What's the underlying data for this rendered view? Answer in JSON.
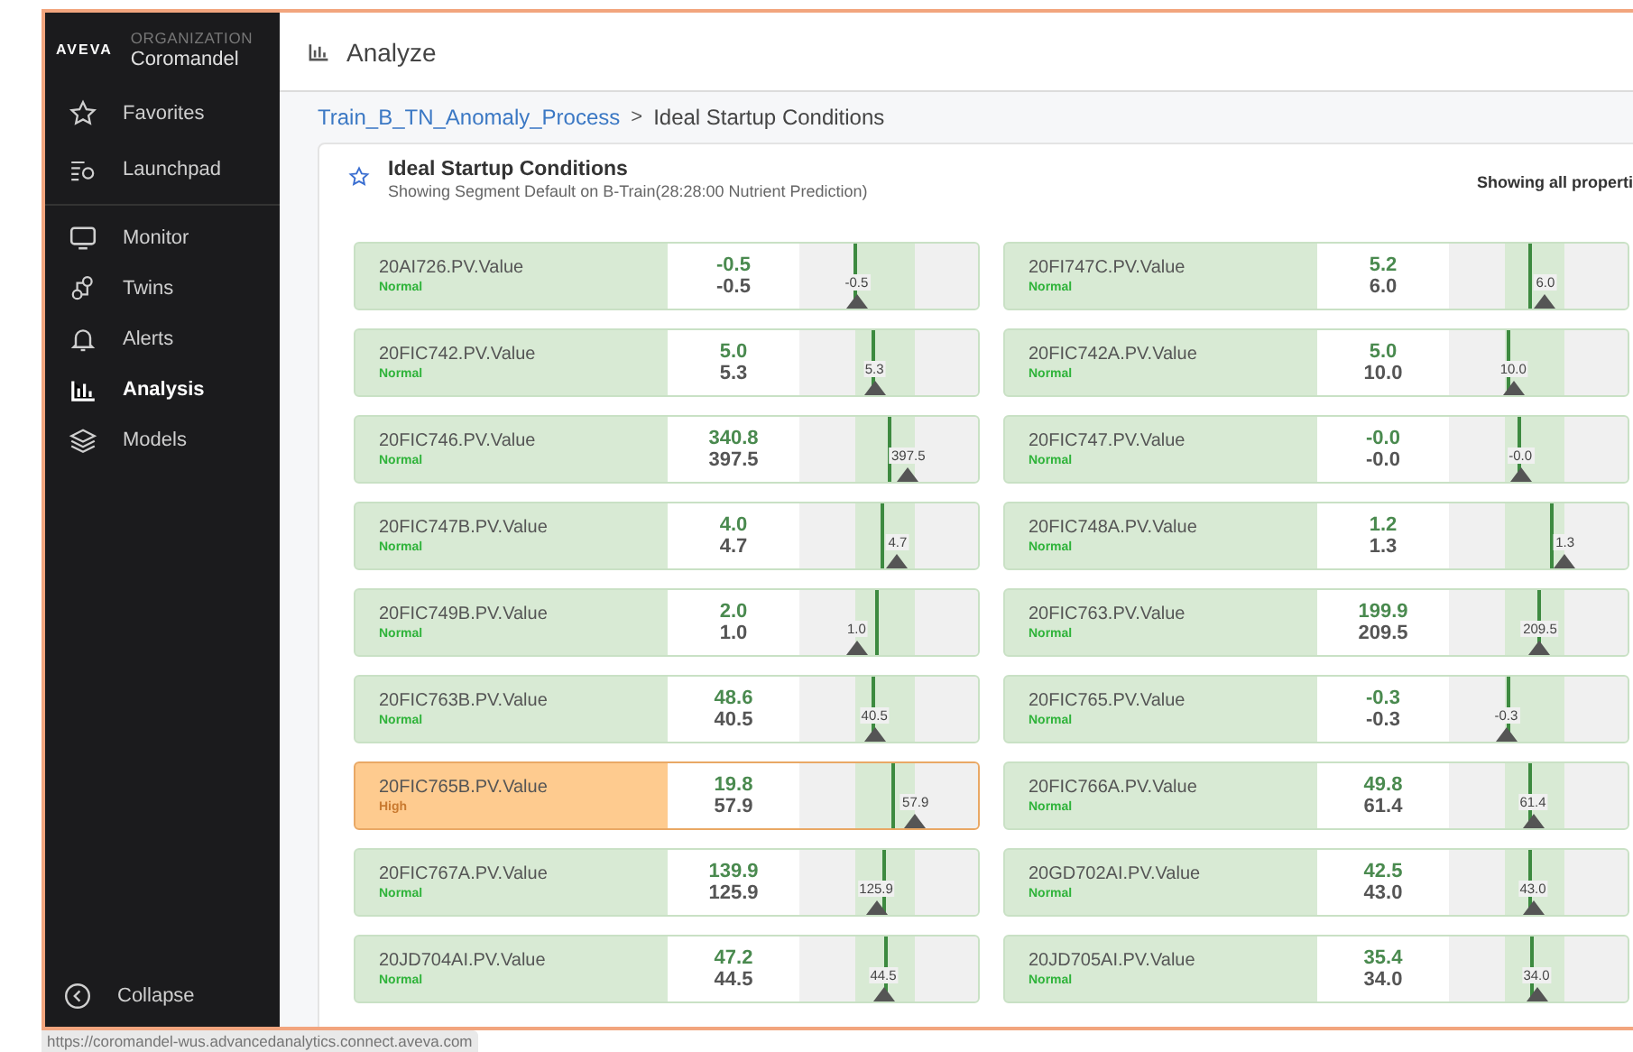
{
  "sidebar": {
    "logo": "AVEVA",
    "org_label": "ORGANIZATION",
    "org_name": "Coromandel",
    "top_items": [
      {
        "label": "Favorites",
        "selected": false
      },
      {
        "label": "Launchpad",
        "selected": false
      }
    ],
    "items": [
      {
        "label": "Monitor",
        "selected": false
      },
      {
        "label": "Twins",
        "selected": false
      },
      {
        "label": "Alerts",
        "selected": false
      },
      {
        "label": "Analysis",
        "selected": true
      },
      {
        "label": "Models",
        "selected": false
      }
    ],
    "collapse": "Collapse"
  },
  "header": {
    "title": "Analyze"
  },
  "breadcrumb": {
    "parent": "Train_B_TN_Anomaly_Process",
    "separator": ">",
    "current": "Ideal Startup Conditions"
  },
  "card": {
    "title": "Ideal Startup Conditions",
    "subtitle": "Showing Segment Default on B-Train(28:28:00 Nutrient Prediction)",
    "filter_note": "Showing all properti"
  },
  "tiles": [
    {
      "name": "20AI726.PV.Value",
      "status": "Normal",
      "kind": "normal",
      "ideal": "-0.5",
      "actual": "-0.5",
      "ideal_line": {
        "level": 0.31
      },
      "actual_marker": {
        "level": 0.32,
        "label": "-0.5"
      }
    },
    {
      "name": "20FI747C.PV.Value",
      "status": "Normal",
      "kind": "normal",
      "ideal": "5.2",
      "actual": "6.0",
      "ideal_line": {
        "level": 0.45
      },
      "actual_marker": {
        "level": 0.54,
        "label": "6.0"
      }
    },
    {
      "name": "20FIC742.PV.Value",
      "status": "Normal",
      "kind": "normal",
      "ideal": "5.0",
      "actual": "5.3",
      "ideal_line": {
        "level": 0.41
      },
      "actual_marker": {
        "level": 0.42,
        "label": "5.3"
      }
    },
    {
      "name": "20FIC742A.PV.Value",
      "status": "Normal",
      "kind": "normal",
      "ideal": "5.0",
      "actual": "10.0",
      "ideal_line": {
        "level": 0.33
      },
      "actual_marker": {
        "level": 0.36,
        "label": "10.0"
      }
    },
    {
      "name": "20FIC746.PV.Value",
      "status": "Normal",
      "kind": "normal",
      "ideal": "340.8",
      "actual": "397.5",
      "ideal_line": {
        "level": 0.5
      },
      "actual_marker": {
        "level": 0.61,
        "label": "397.5"
      }
    },
    {
      "name": "20FIC747.PV.Value",
      "status": "Normal",
      "kind": "normal",
      "ideal": "-0.0",
      "actual": "-0.0",
      "ideal_line": {
        "level": 0.39
      },
      "actual_marker": {
        "level": 0.4,
        "label": "-0.0"
      }
    },
    {
      "name": "20FIC747B.PV.Value",
      "status": "Normal",
      "kind": "normal",
      "ideal": "4.0",
      "actual": "4.7",
      "ideal_line": {
        "level": 0.46
      },
      "actual_marker": {
        "level": 0.55,
        "label": "4.7"
      }
    },
    {
      "name": "20FIC748A.PV.Value",
      "status": "Normal",
      "kind": "normal",
      "ideal": "1.2",
      "actual": "1.3",
      "ideal_line": {
        "level": 0.58
      },
      "actual_marker": {
        "level": 0.65,
        "label": "1.3"
      }
    },
    {
      "name": "20FIC749B.PV.Value",
      "status": "Normal",
      "kind": "normal",
      "ideal": "2.0",
      "actual": "1.0",
      "ideal_line": {
        "level": 0.43
      },
      "actual_marker": {
        "level": 0.32,
        "label": "1.0"
      }
    },
    {
      "name": "20FIC763.PV.Value",
      "status": "Normal",
      "kind": "normal",
      "ideal": "199.9",
      "actual": "209.5",
      "ideal_line": {
        "level": 0.5
      },
      "actual_marker": {
        "level": 0.51,
        "label": "209.5"
      }
    },
    {
      "name": "20FIC763B.PV.Value",
      "status": "Normal",
      "kind": "normal",
      "ideal": "48.6",
      "actual": "40.5",
      "ideal_line": {
        "level": 0.41
      },
      "actual_marker": {
        "level": 0.42,
        "label": "40.5"
      }
    },
    {
      "name": "20FIC765.PV.Value",
      "status": "Normal",
      "kind": "normal",
      "ideal": "-0.3",
      "actual": "-0.3",
      "ideal_line": {
        "level": 0.33
      },
      "actual_marker": {
        "level": 0.32,
        "label": "-0.3"
      }
    },
    {
      "name": "20FIC765B.PV.Value",
      "status": "High",
      "kind": "high",
      "ideal": "19.8",
      "actual": "57.9",
      "ideal_line": {
        "level": 0.53
      },
      "actual_marker": {
        "level": 0.65,
        "label": "57.9"
      }
    },
    {
      "name": "20FIC766A.PV.Value",
      "status": "Normal",
      "kind": "normal",
      "ideal": "49.8",
      "actual": "61.4",
      "ideal_line": {
        "level": 0.45
      },
      "actual_marker": {
        "level": 0.47,
        "label": "61.4"
      }
    },
    {
      "name": "20FIC767A.PV.Value",
      "status": "Normal",
      "kind": "normal",
      "ideal": "139.9",
      "actual": "125.9",
      "ideal_line": {
        "level": 0.47
      },
      "actual_marker": {
        "level": 0.43,
        "label": "125.9"
      }
    },
    {
      "name": "20GD702AI.PV.Value",
      "status": "Normal",
      "kind": "normal",
      "ideal": "42.5",
      "actual": "43.0",
      "ideal_line": {
        "level": 0.45
      },
      "actual_marker": {
        "level": 0.47,
        "label": "43.0"
      }
    },
    {
      "name": "20JD704AI.PV.Value",
      "status": "Normal",
      "kind": "normal",
      "ideal": "47.2",
      "actual": "44.5",
      "ideal_line": {
        "level": 0.48
      },
      "actual_marker": {
        "level": 0.47,
        "label": "44.5"
      }
    },
    {
      "name": "20JD705AI.PV.Value",
      "status": "Normal",
      "kind": "normal",
      "ideal": "35.4",
      "actual": "34.0",
      "ideal_line": {
        "level": 0.46
      },
      "actual_marker": {
        "level": 0.49,
        "label": "34.0"
      }
    }
  ],
  "status_bar": {
    "url": "https://coromandel-wus.advancedanalytics.connect.aveva.com"
  }
}
